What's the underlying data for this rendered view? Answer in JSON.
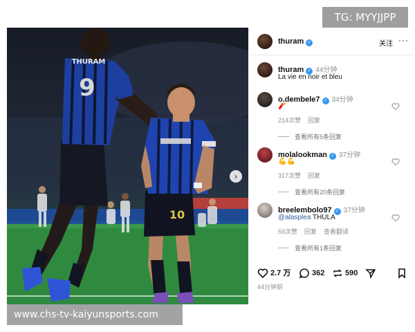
{
  "watermark_top": "TG: MYYJJPP",
  "watermark_bottom": "www.chs-tv-kaiyunsports.com",
  "photo": {
    "player1_name": "THURAM",
    "player1_number": "9",
    "player2_number": "10",
    "next_icon": "chevron-right-icon"
  },
  "header": {
    "username": "thuram",
    "verified_icon": "verified-badge-icon",
    "follow_label": "关注",
    "more_label": "···"
  },
  "caption": {
    "username": "thuram",
    "time": "44分钟",
    "text": "La vie en noir et bleu"
  },
  "comments": [
    {
      "username": "o.dembele7",
      "time": "34分钟",
      "text": "🧨",
      "likes": "214次赞",
      "reply_label": "回复",
      "extra_label": "",
      "view_replies": "查看所有5条回复"
    },
    {
      "username": "molalookman",
      "time": "37分钟",
      "text": "💪💪",
      "likes": "317次赞",
      "reply_label": "回复",
      "extra_label": "",
      "view_replies": "查看所有20条回复"
    },
    {
      "username": "breelembolo97",
      "time": "37分钟",
      "text_mention": "@alasplea",
      "text": "THULA",
      "likes": "59次赞",
      "reply_label": "回复",
      "extra_label": "查看翻译",
      "view_replies": "查看所有1条回复"
    }
  ],
  "actions": {
    "likes": "2.7 万",
    "comments": "362",
    "reposts": "590"
  },
  "posted_time": "44分钟前",
  "colors": {
    "verified": "#3897f0",
    "inter_blue": "#1d3fa0",
    "muted_text": "#8e8e8e"
  }
}
